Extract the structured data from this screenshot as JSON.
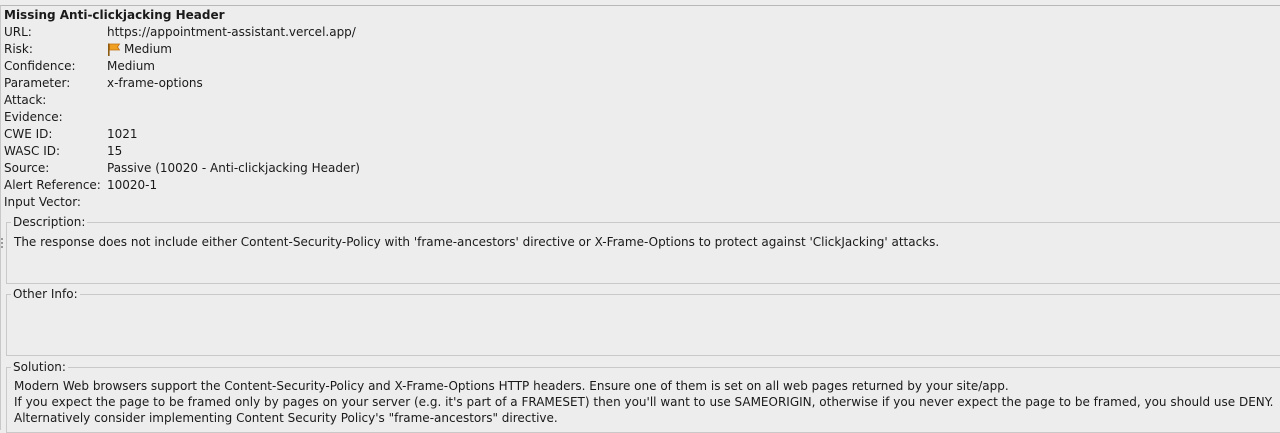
{
  "alert": {
    "title": "Missing Anti-clickjacking Header",
    "fields": [
      {
        "label": "URL:",
        "value": "https://appointment-assistant.vercel.app/"
      },
      {
        "label": "Risk:",
        "value": "Medium"
      },
      {
        "label": "Confidence:",
        "value": "Medium"
      },
      {
        "label": "Parameter:",
        "value": "x-frame-options"
      },
      {
        "label": "Attack:",
        "value": ""
      },
      {
        "label": "Evidence:",
        "value": ""
      },
      {
        "label": "CWE ID:",
        "value": "1021"
      },
      {
        "label": "WASC ID:",
        "value": "15"
      },
      {
        "label": "Source:",
        "value": "Passive (10020 - Anti-clickjacking Header)"
      },
      {
        "label": "Alert Reference:",
        "value": "10020-1"
      },
      {
        "label": "Input Vector:",
        "value": ""
      }
    ],
    "risk_icon": "orange-flag-icon",
    "risk_color": "#f0a020"
  },
  "description": {
    "legend": "Description:",
    "text": "The response does not include either Content-Security-Policy with 'frame-ancestors' directive or X-Frame-Options to protect against 'ClickJacking' attacks."
  },
  "other_info": {
    "legend": "Other Info:",
    "text": ""
  },
  "solution": {
    "legend": "Solution:",
    "line1": "Modern Web browsers support the Content-Security-Policy and X-Frame-Options HTTP headers. Ensure one of them is set on all web pages returned by your site/app.",
    "line2": "If you expect the page to be framed only by pages on your server (e.g. it's part of a FRAMESET) then you'll want to use SAMEORIGIN, otherwise if you never expect the page to be framed, you should use DENY. Alternatively consider implementing Content Security Policy's \"frame-ancestors\" directive."
  }
}
